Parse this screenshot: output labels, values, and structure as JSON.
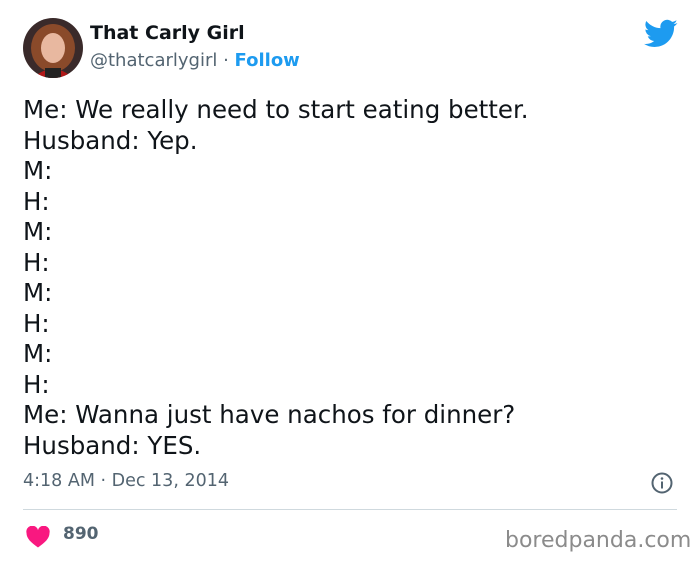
{
  "user": {
    "display_name": "That Carly Girl",
    "handle": "@thatcarlygirl",
    "separator": " · ",
    "follow_label": "Follow"
  },
  "tweet": {
    "lines": [
      "Me: We really need to start eating better.",
      "Husband: Yep.",
      "M:",
      "H:",
      "M:",
      "H:",
      "M:",
      "H:",
      "M:",
      "H:",
      "Me: Wanna just have nachos for dinner?",
      "Husband: YES."
    ],
    "timestamp": "4:18 AM · Dec 13, 2014"
  },
  "engagement": {
    "likes": "890"
  },
  "watermark": "boredpanda.com",
  "colors": {
    "link": "#1d9bf0",
    "heart": "#f91880",
    "secondary_text": "#536471"
  },
  "icons": {
    "brand": "twitter-bird-icon",
    "info": "info-icon",
    "like": "heart-icon"
  }
}
